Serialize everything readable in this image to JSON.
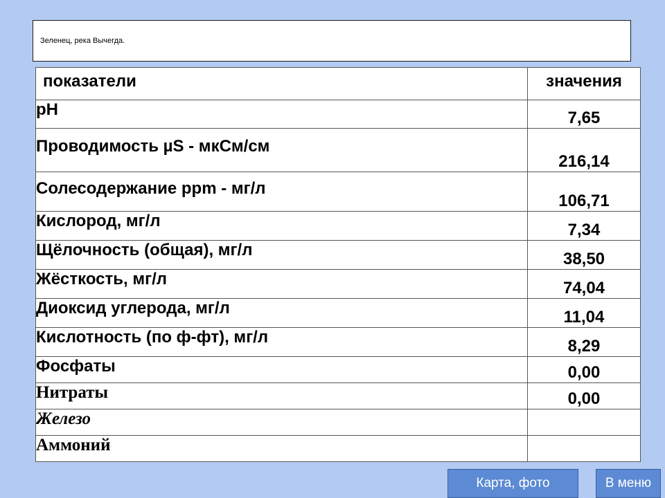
{
  "header": {
    "title": "Зеленец, река Вычегда."
  },
  "table": {
    "columns": [
      "показатели",
      "значения"
    ],
    "rows": [
      {
        "name": "pH",
        "value": "7,65"
      },
      {
        "name": "Проводимость  µS - мкСм/см",
        "value": "216,14"
      },
      {
        "name": "Солесодержание  ppm - мг/л",
        "value": "106,71"
      },
      {
        "name": "Кислород, мг/л",
        "value": "7,34"
      },
      {
        "name": "Щёлочность (общая),   мг/л",
        "value": "38,50"
      },
      {
        "name": "Жёсткость, мг/л",
        "value": "74,04"
      },
      {
        "name": "Диоксид углерода, мг/л",
        "value": "11,04"
      },
      {
        "name": "Кислотность (по ф-фт), мг/л",
        "value": "8,29"
      },
      {
        "name": "Фосфаты",
        "value": "0,00"
      },
      {
        "name": "Нитраты",
        "value": "0,00"
      },
      {
        "name": "Железо",
        "value": ""
      },
      {
        "name": "Аммоний",
        "value": ""
      }
    ]
  },
  "buttons": {
    "map_photo": "Карта, фото",
    "menu": "В меню"
  }
}
